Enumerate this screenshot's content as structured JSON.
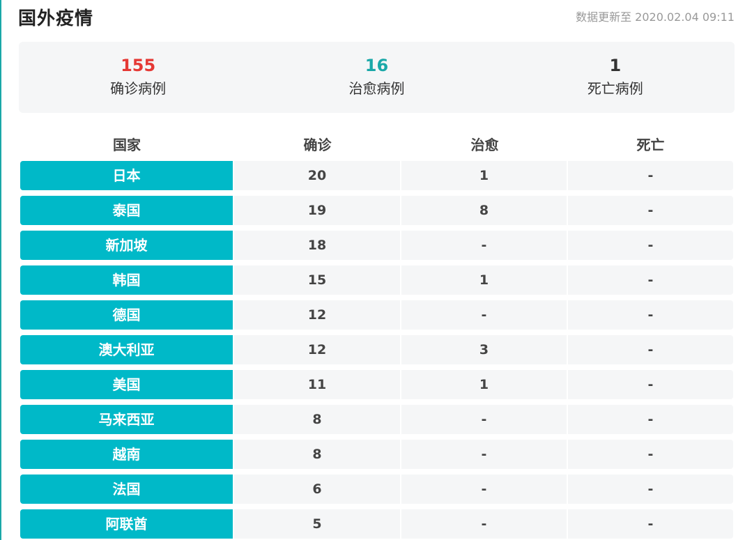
{
  "header": {
    "title": "国外疫情",
    "update_text": "数据更新至 2020.02.04 09:11"
  },
  "summary": [
    {
      "value": "155",
      "label": "确诊病例",
      "color": "#e53935"
    },
    {
      "value": "16",
      "label": "治愈病例",
      "color": "#1aa8a8"
    },
    {
      "value": "1",
      "label": "死亡病例",
      "color": "#333333"
    }
  ],
  "table": {
    "columns": [
      "国家",
      "确诊",
      "治愈",
      "死亡"
    ],
    "rows": [
      {
        "country": "日本",
        "confirmed": "20",
        "cured": "1",
        "dead": "-"
      },
      {
        "country": "泰国",
        "confirmed": "19",
        "cured": "8",
        "dead": "-"
      },
      {
        "country": "新加坡",
        "confirmed": "18",
        "cured": "-",
        "dead": "-"
      },
      {
        "country": "韩国",
        "confirmed": "15",
        "cured": "1",
        "dead": "-"
      },
      {
        "country": "德国",
        "confirmed": "12",
        "cured": "-",
        "dead": "-"
      },
      {
        "country": "澳大利亚",
        "confirmed": "12",
        "cured": "3",
        "dead": "-"
      },
      {
        "country": "美国",
        "confirmed": "11",
        "cured": "1",
        "dead": "-"
      },
      {
        "country": "马来西亚",
        "confirmed": "8",
        "cured": "-",
        "dead": "-"
      },
      {
        "country": "越南",
        "confirmed": "8",
        "cured": "-",
        "dead": "-"
      },
      {
        "country": "法国",
        "confirmed": "6",
        "cured": "-",
        "dead": "-"
      },
      {
        "country": "阿联酋",
        "confirmed": "5",
        "cured": "-",
        "dead": "-"
      }
    ]
  },
  "colors": {
    "accent": "#00b9c8",
    "confirmed": "#e53935",
    "cured": "#1aa8a8",
    "panel_bg": "#f5f6f7"
  }
}
